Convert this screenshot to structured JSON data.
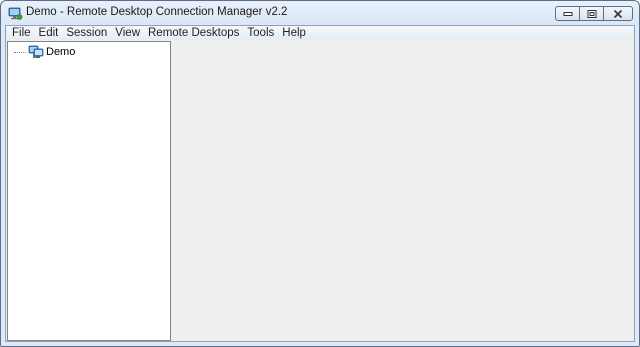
{
  "window": {
    "title": "Demo - Remote Desktop Connection Manager v2.2",
    "icon": "remote-desktop-app-icon"
  },
  "caption_buttons": {
    "minimize_icon": "minimize-icon",
    "maximize_icon": "maximize-icon",
    "close_icon": "close-icon"
  },
  "menubar": {
    "items": [
      {
        "label": "File"
      },
      {
        "label": "Edit"
      },
      {
        "label": "Session"
      },
      {
        "label": "View"
      },
      {
        "label": "Remote Desktops"
      },
      {
        "label": "Tools"
      },
      {
        "label": "Help"
      }
    ]
  },
  "tree": {
    "root": {
      "label": "Demo",
      "icon": "server-group-icon"
    }
  },
  "colors": {
    "title_bg": "#dbe7f5",
    "client_bg": "#efefef",
    "tree_bg": "#ffffff"
  }
}
